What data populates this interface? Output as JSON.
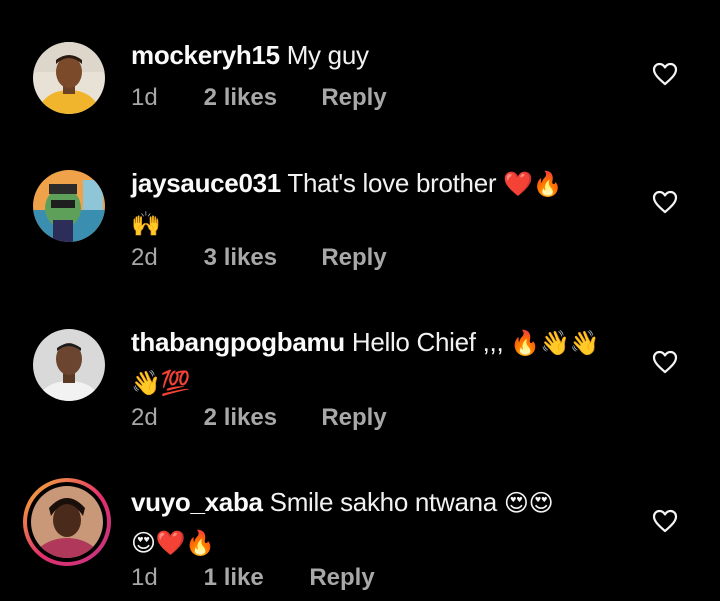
{
  "comments": [
    {
      "username": "mockeryh15",
      "text": "My guy",
      "emojis": "",
      "emojis_line2": "",
      "time": "1d",
      "likes": "2 likes",
      "reply": "Reply"
    },
    {
      "username": "jaysauce031",
      "text": "That's love brother",
      "emojis": "❤️🔥",
      "emojis_line2": "🙌",
      "time": "2d",
      "likes": "3 likes",
      "reply": "Reply"
    },
    {
      "username": "thabangpogbamu",
      "text": "Hello Chief ,,,",
      "emojis": "🔥👋👋",
      "emojis_line2": "👋💯",
      "time": "2d",
      "likes": "2 likes",
      "reply": "Reply"
    },
    {
      "username": "vuyo_xaba",
      "text": "Smile sakho ntwana",
      "emojis": "😍😍",
      "emojis_line2": "😍❤️🔥",
      "time": "1d",
      "likes": "1 like",
      "reply": "Reply"
    }
  ],
  "icons": {
    "like": "heart-outline-icon"
  },
  "colors": {
    "background": "#000000",
    "meta_text": "#a8a8a8",
    "story_ring_start": "#f7b733",
    "story_ring_end": "#c13584"
  }
}
